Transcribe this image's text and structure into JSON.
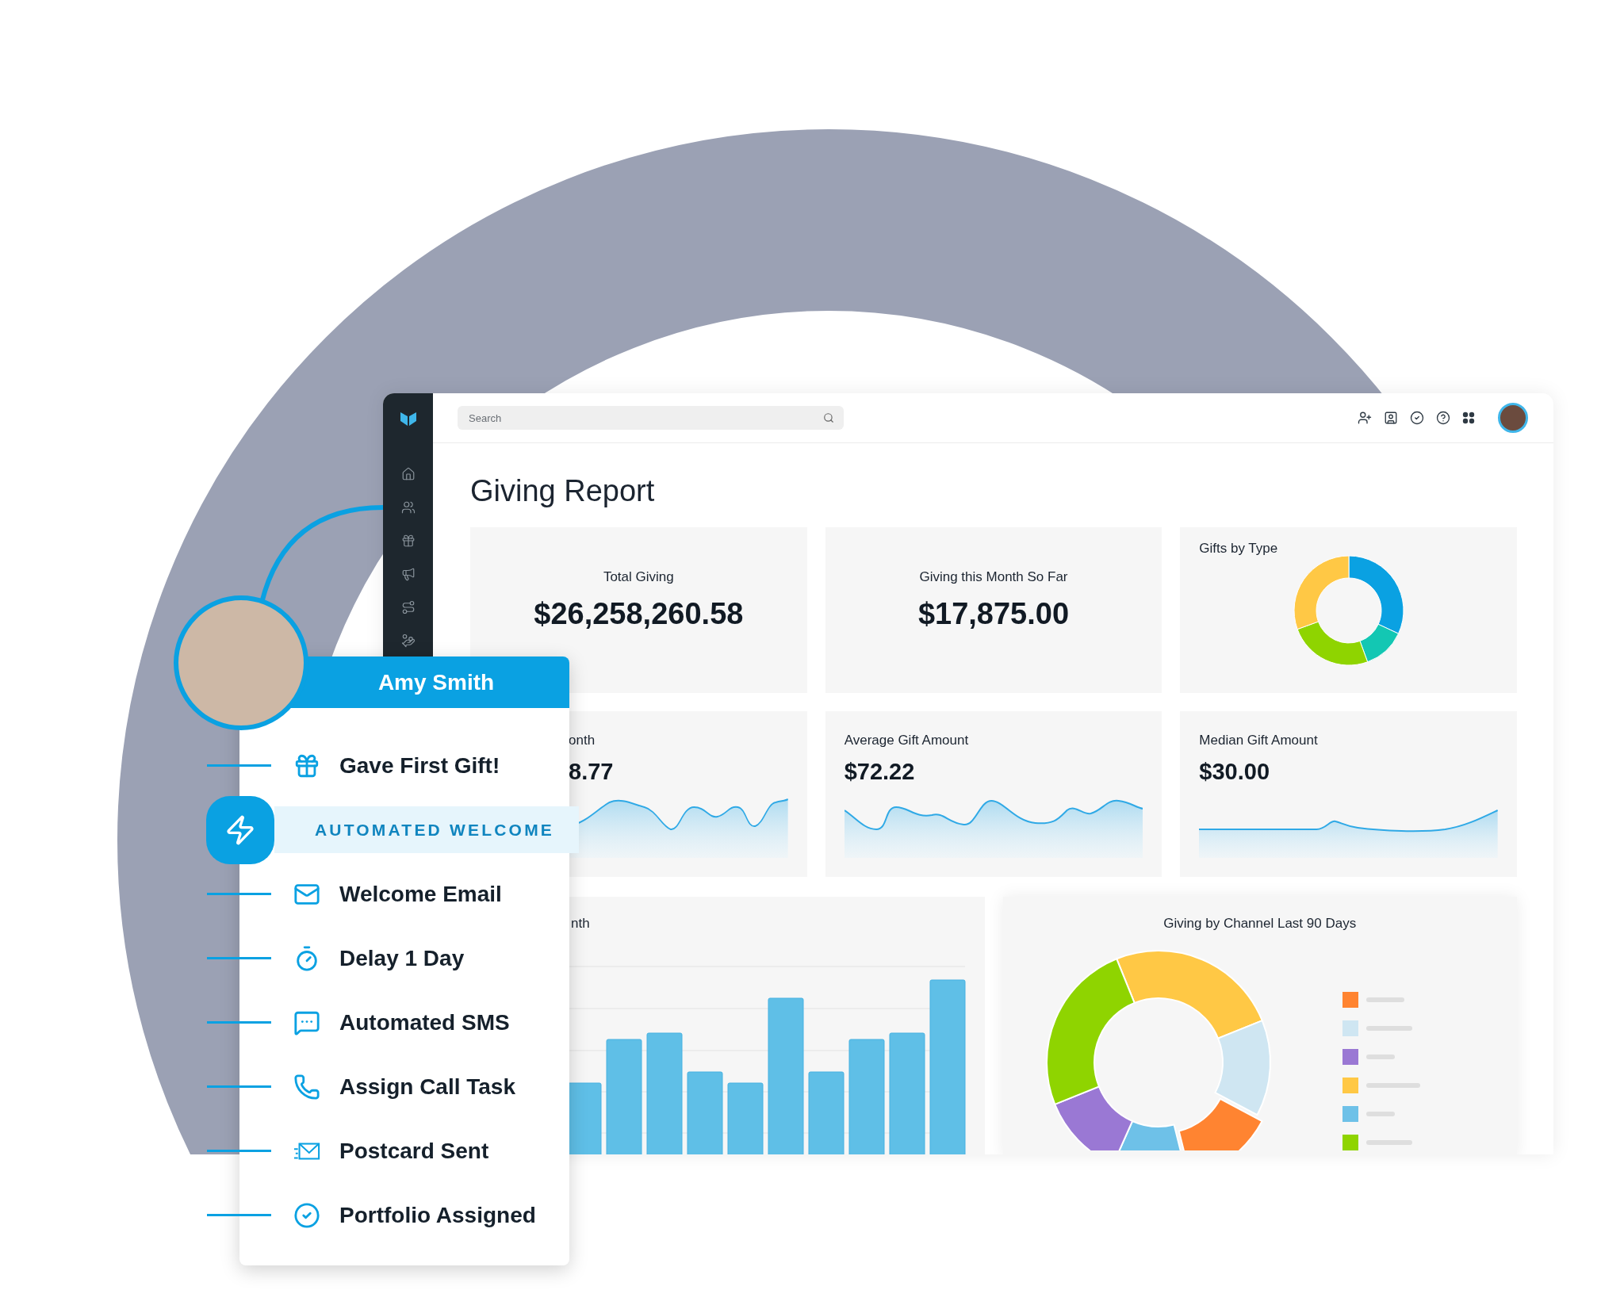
{
  "dashboard": {
    "search": {
      "placeholder": "Search"
    },
    "title": "Giving Report",
    "cards": [
      {
        "kind": "total",
        "title": "Total Giving",
        "value": "$26,258,260.58"
      },
      {
        "kind": "total",
        "title": "Giving this Month So Far",
        "value": "$17,875.00"
      },
      {
        "kind": "donut",
        "title": "Gifts by Type"
      },
      {
        "kind": "trend",
        "title": "onth",
        "value": "8.77"
      },
      {
        "kind": "trend",
        "title": "Average Gift Amount",
        "value": "$72.22"
      },
      {
        "kind": "trend",
        "title": "Median Gift Amount",
        "value": "$30.00"
      }
    ],
    "panels": [
      {
        "kind": "bars",
        "title": "nth"
      },
      {
        "kind": "channels",
        "title": "Giving by Channel Last 90 Days"
      }
    ]
  },
  "contact": {
    "name": "Amy Smith"
  },
  "journey": {
    "trigger": {
      "kind": "gift",
      "label": "Gave First Gift!"
    },
    "automation": {
      "label": "AUTOMATED WELCOME"
    },
    "steps": [
      {
        "kind": "email",
        "label": "Welcome Email"
      },
      {
        "kind": "delay",
        "label": "Delay 1 Day"
      },
      {
        "kind": "sms",
        "label": "Automated SMS"
      },
      {
        "kind": "call",
        "label": "Assign Call Task"
      },
      {
        "kind": "postcard",
        "label": "Postcard Sent"
      },
      {
        "kind": "portfolio",
        "label": "Portfolio Assigned"
      }
    ]
  }
}
